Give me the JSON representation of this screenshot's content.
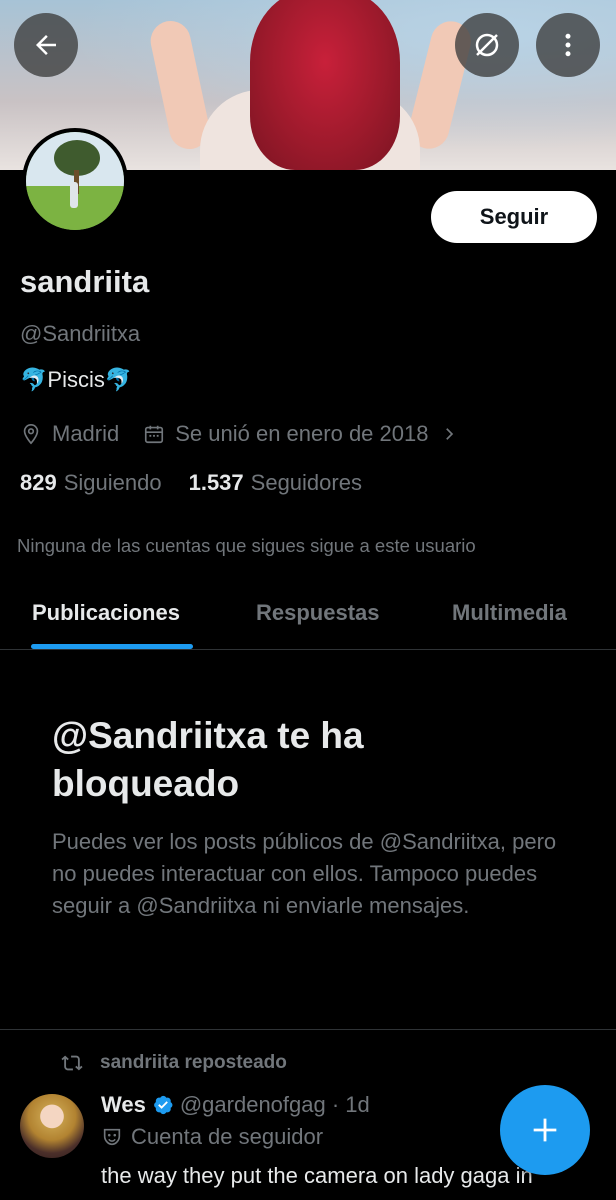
{
  "profile": {
    "name": "sandriita",
    "handle": "@Sandriitxa",
    "bio": "🐬Piscis🐬",
    "location": "Madrid",
    "joined": "Se unió en enero de 2018",
    "following_count": "829",
    "following_label": "Siguiendo",
    "followers_count": "1.537",
    "followers_label": "Seguidores",
    "mutual_text": "Ninguna de las cuentas que sigues sigue a este usuario"
  },
  "actions": {
    "follow_label": "Seguir"
  },
  "tabs": [
    {
      "label": "Publicaciones",
      "active": true
    },
    {
      "label": "Respuestas",
      "active": false
    },
    {
      "label": "Multimedia",
      "active": false
    }
  ],
  "blocked": {
    "title": "@Sandriitxa te ha bloqueado",
    "text": "Puedes ver los posts públicos de @Sandriitxa, pero no puedes interactuar con ellos. Tampoco puedes seguir a @Sandriitxa ni enviarle mensajes."
  },
  "post": {
    "repost_label": "sandriita reposteado",
    "author_name": "Wes",
    "author_handle": "@gardenofgag · 1d",
    "subtitle": "Cuenta de seguidor",
    "text": "the way they put the camera on lady gaga in"
  },
  "colors": {
    "accent": "#1d9bf0",
    "muted": "#71767b",
    "text": "#e7e9ea"
  }
}
